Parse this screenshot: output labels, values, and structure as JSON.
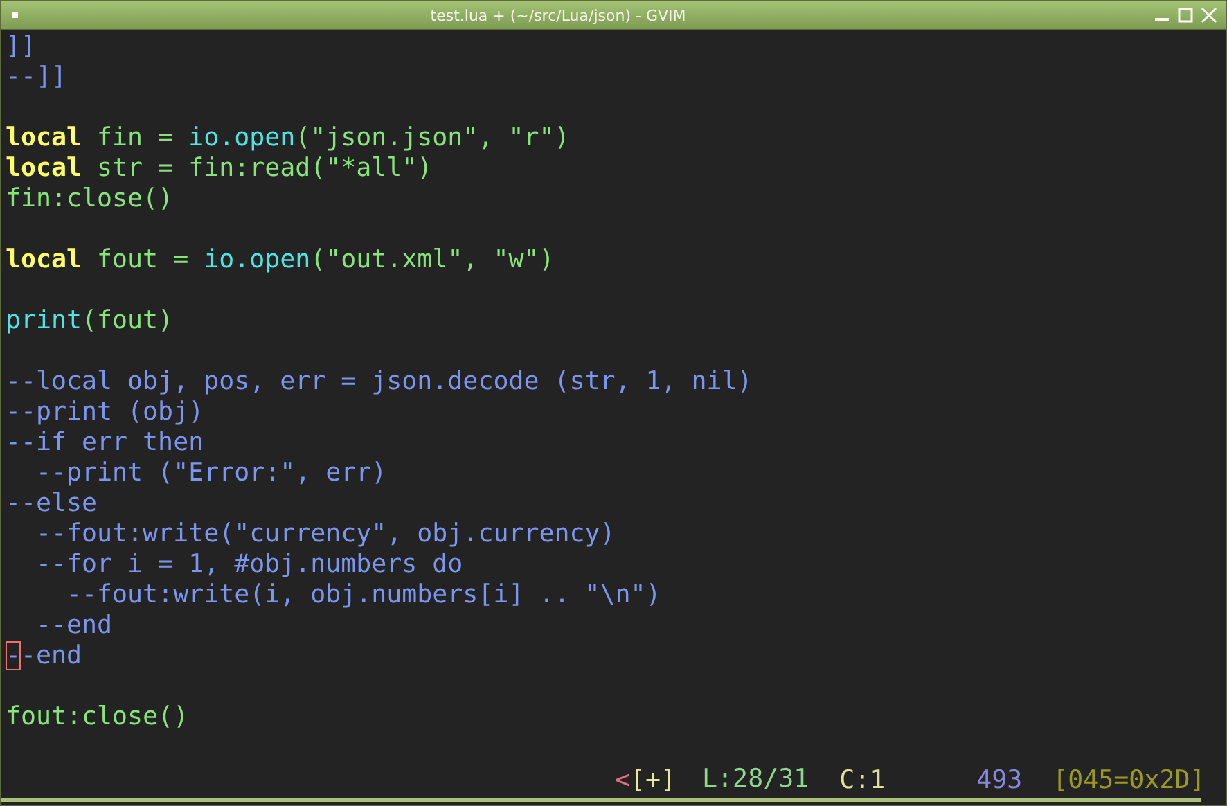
{
  "window": {
    "title": "test.lua + (~/src/Lua/json) - GVIM"
  },
  "editor": {
    "lines": [
      {
        "kind": "code",
        "segments": [
          {
            "kind": "comment",
            "text": "]]"
          }
        ]
      },
      {
        "kind": "code",
        "segments": [
          {
            "kind": "comment",
            "text": "--]]"
          }
        ]
      },
      {
        "kind": "blank"
      },
      {
        "kind": "code",
        "segments": [
          {
            "kind": "keyword",
            "text": "local"
          },
          {
            "kind": "plain",
            "text": " fin = "
          },
          {
            "kind": "builtin",
            "text": "io.open"
          },
          {
            "kind": "plain",
            "text": "(\"json.json\", \"r\")"
          }
        ]
      },
      {
        "kind": "code",
        "segments": [
          {
            "kind": "keyword",
            "text": "local"
          },
          {
            "kind": "plain",
            "text": " str = fin:read(\"*all\")"
          }
        ]
      },
      {
        "kind": "code",
        "segments": [
          {
            "kind": "plain",
            "text": "fin:close()"
          }
        ]
      },
      {
        "kind": "blank"
      },
      {
        "kind": "code",
        "segments": [
          {
            "kind": "keyword",
            "text": "local"
          },
          {
            "kind": "plain",
            "text": " fout = "
          },
          {
            "kind": "builtin",
            "text": "io.open"
          },
          {
            "kind": "plain",
            "text": "(\"out.xml\", \"w\")"
          }
        ]
      },
      {
        "kind": "blank"
      },
      {
        "kind": "code",
        "segments": [
          {
            "kind": "builtin",
            "text": "print"
          },
          {
            "kind": "plain",
            "text": "(fout)"
          }
        ]
      },
      {
        "kind": "blank"
      },
      {
        "kind": "code",
        "segments": [
          {
            "kind": "comment",
            "text": "--local obj, pos, err = json.decode (str, 1, nil)"
          }
        ]
      },
      {
        "kind": "code",
        "segments": [
          {
            "kind": "comment",
            "text": "--print (obj)"
          }
        ]
      },
      {
        "kind": "code",
        "segments": [
          {
            "kind": "comment",
            "text": "--if err then"
          }
        ]
      },
      {
        "kind": "code",
        "segments": [
          {
            "kind": "comment",
            "text": "  --print (\"Error:\", err)"
          }
        ]
      },
      {
        "kind": "code",
        "segments": [
          {
            "kind": "comment",
            "text": "--else"
          }
        ]
      },
      {
        "kind": "code",
        "segments": [
          {
            "kind": "comment",
            "text": "  --fout:write(\"currency\", obj.currency)"
          }
        ]
      },
      {
        "kind": "code",
        "segments": [
          {
            "kind": "comment",
            "text": "  --for i = 1, #obj.numbers do"
          }
        ]
      },
      {
        "kind": "code",
        "segments": [
          {
            "kind": "comment",
            "text": "    --fout:write(i, obj.numbers[i] .. \"\\n\")"
          }
        ]
      },
      {
        "kind": "code",
        "segments": [
          {
            "kind": "comment",
            "text": "  --end"
          }
        ]
      },
      {
        "kind": "code",
        "segments": [
          {
            "kind": "cursor",
            "text": "-"
          },
          {
            "kind": "comment",
            "text": "-end"
          }
        ]
      },
      {
        "kind": "blank"
      },
      {
        "kind": "code",
        "segments": [
          {
            "kind": "plain",
            "text": "fout:close()"
          }
        ]
      }
    ]
  },
  "status_bar": [
    {
      "kind": "flag",
      "text": "<"
    },
    {
      "kind": "modified",
      "text": "[+]"
    },
    {
      "kind": "line",
      "text": "L:28/31"
    },
    {
      "kind": "column",
      "text": "C:1"
    },
    {
      "kind": "count",
      "text": "493"
    },
    {
      "kind": "char",
      "text": "[045=0x2D]"
    }
  ]
}
